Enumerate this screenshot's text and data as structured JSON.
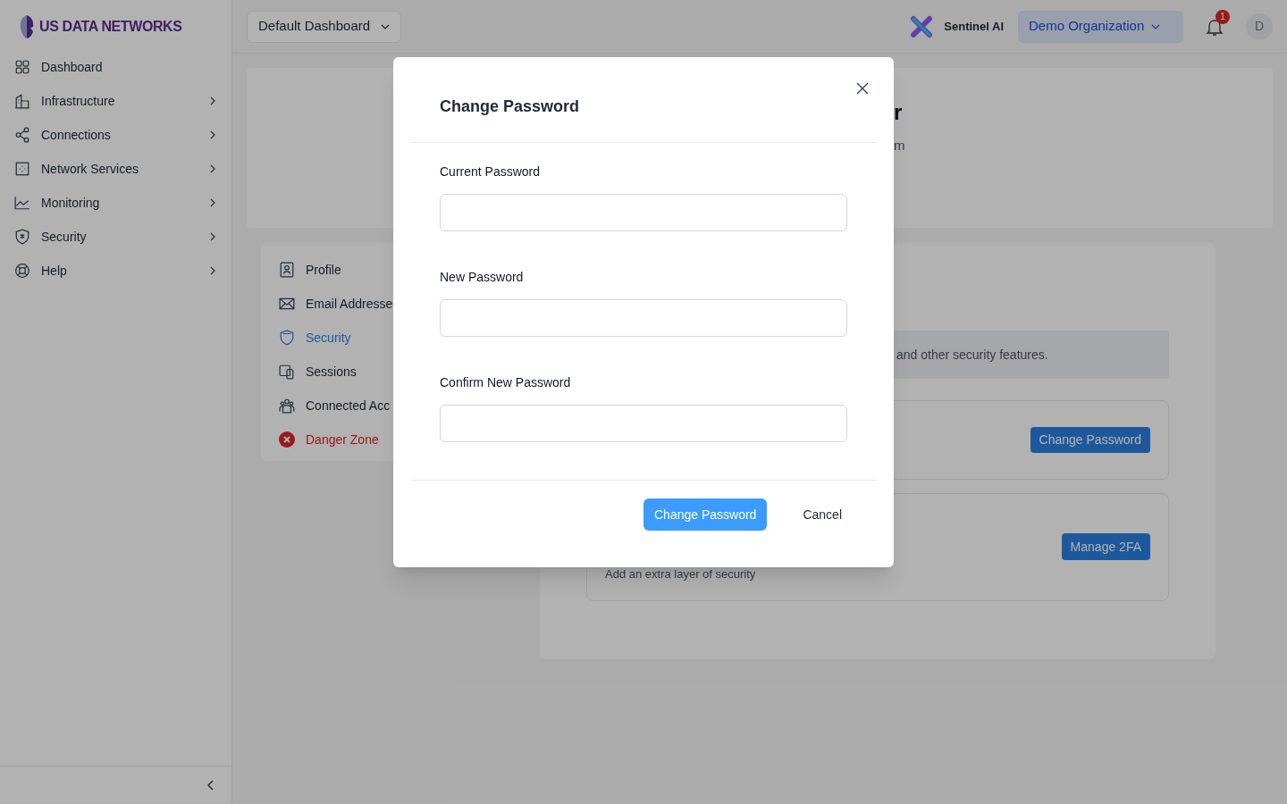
{
  "sidebar": {
    "brand": "US DATA NETWORKS",
    "items": [
      {
        "label": "Dashboard",
        "has_children": false
      },
      {
        "label": "Infrastructure",
        "has_children": true
      },
      {
        "label": "Connections",
        "has_children": true
      },
      {
        "label": "Network Services",
        "has_children": true
      },
      {
        "label": "Monitoring",
        "has_children": true
      },
      {
        "label": "Security",
        "has_children": true
      },
      {
        "label": "Help",
        "has_children": true
      }
    ]
  },
  "header": {
    "dashboard_select": "Default Dashboard",
    "assistant": "Sentinel AI",
    "organization": "Demo Organization",
    "notification_count": "1",
    "avatar": "D"
  },
  "profile_card": {
    "heading_fragment": "r",
    "email_fragment": "m"
  },
  "settings_nav": [
    {
      "label": "Profile",
      "kind": "normal",
      "selected": false
    },
    {
      "label": "Email Addresse",
      "kind": "normal",
      "selected": false
    },
    {
      "label": "Security",
      "kind": "normal",
      "selected": true
    },
    {
      "label": "Sessions",
      "kind": "normal",
      "selected": false
    },
    {
      "label": "Connected Acc",
      "kind": "normal",
      "selected": false
    },
    {
      "label": "Danger Zone",
      "kind": "danger",
      "selected": false
    }
  ],
  "security_panel": {
    "info": "and other security features.",
    "password_button": "Change Password",
    "twofa_description": "Add an extra layer of security",
    "twofa_button": "Manage 2FA"
  },
  "dialog": {
    "title": "Change Password",
    "fields": [
      {
        "label": "Current Password"
      },
      {
        "label": "New Password"
      },
      {
        "label": "Confirm New Password"
      }
    ],
    "submit": "Change Password",
    "cancel": "Cancel"
  }
}
